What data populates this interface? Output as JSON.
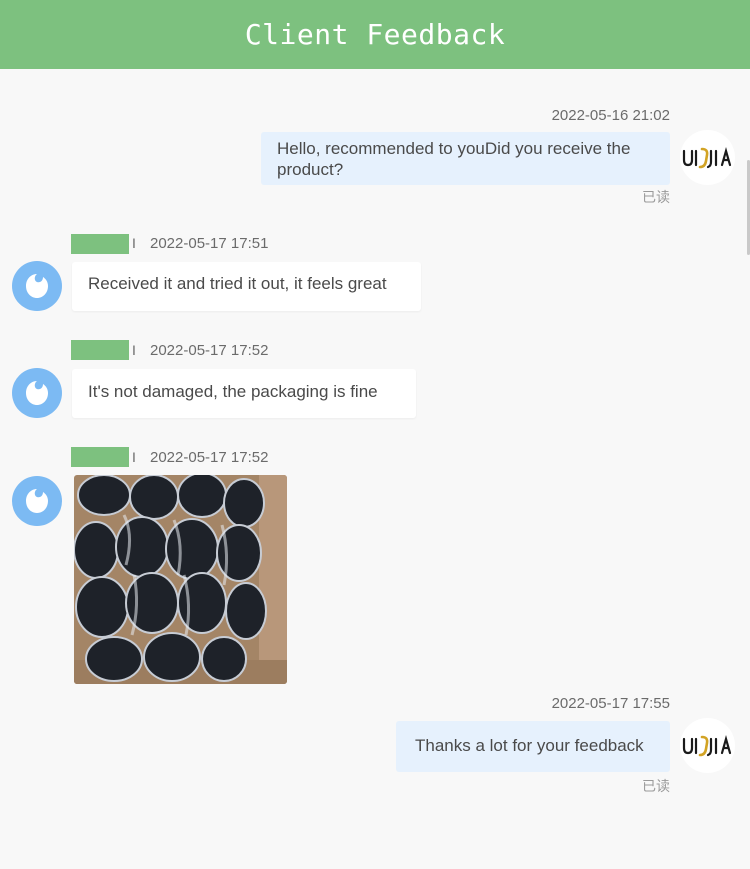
{
  "header": {
    "title": "Client Feedback"
  },
  "brand_logo_text": "UI∫JIA",
  "colors": {
    "header_bg": "#7dc17f",
    "outgoing_bubble": "#e6f1fd",
    "incoming_bubble": "#ffffff",
    "client_avatar": "#7cbaf3",
    "logo_accent": "#d2a324"
  },
  "messages": [
    {
      "direction": "outgoing",
      "timestamp": "2022-05-16 21:02",
      "text": "Hello, recommended to youDid you receive the product?",
      "status": "已读",
      "avatar_icon": "brand-logo-icon"
    },
    {
      "direction": "incoming",
      "name_sep": "I",
      "timestamp": "2022-05-17 17:51",
      "text": "Received it and tried it out, it feels great",
      "avatar_icon": "client-avatar-icon"
    },
    {
      "direction": "incoming",
      "name_sep": "I",
      "timestamp": "2022-05-17 17:52",
      "text": "It's not damaged, the packaging is fine",
      "avatar_icon": "client-avatar-icon"
    },
    {
      "direction": "incoming",
      "name_sep": "I",
      "timestamp": "2022-05-17 17:52",
      "image": "product-photo",
      "avatar_icon": "client-avatar-icon"
    },
    {
      "direction": "outgoing",
      "timestamp": "2022-05-17 17:55",
      "text": "Thanks a lot for your feedback",
      "status": "已读",
      "avatar_icon": "brand-logo-icon"
    }
  ]
}
